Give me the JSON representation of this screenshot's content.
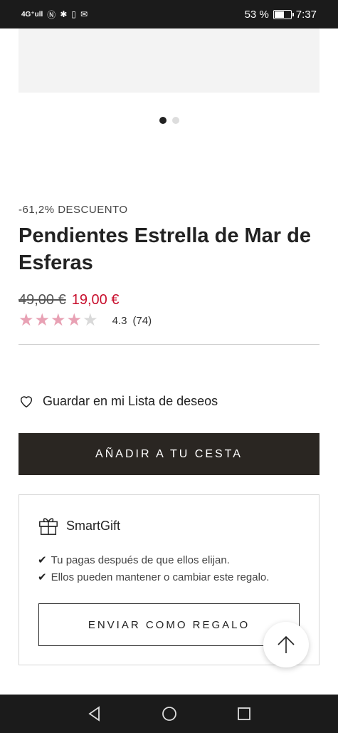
{
  "status_bar": {
    "network": "4G⁺ull",
    "battery": "53 %",
    "time": "7:37"
  },
  "carousel": {
    "dots": 2,
    "active_index": 0
  },
  "product": {
    "discount": "-61,2% DESCUENTO",
    "title": "Pendientes Estrella de Mar de Esferas",
    "old_price": "49,00 €",
    "new_price": "19,00 €",
    "rating_value": "4.3",
    "rating_count": "(74)",
    "stars_filled": 4.3
  },
  "wishlist": {
    "label": "Guardar en mi Lista de deseos"
  },
  "add_to_cart": {
    "label": "AÑADIR A TU CESTA"
  },
  "smartgift": {
    "title": "SmartGift",
    "points": [
      "Tu pagas después de que ellos elijan.",
      "Ellos pueden mantener o cambiar este regalo."
    ],
    "button": "ENVIAR COMO REGALO"
  },
  "colors": {
    "accent_price": "#c8102e",
    "dark_button": "#2a2622",
    "star": "#e8a1b4"
  },
  "icons": [
    "heart-icon",
    "gift-icon",
    "check-icon",
    "arrow-up-icon",
    "back-icon",
    "home-icon",
    "recents-icon"
  ]
}
